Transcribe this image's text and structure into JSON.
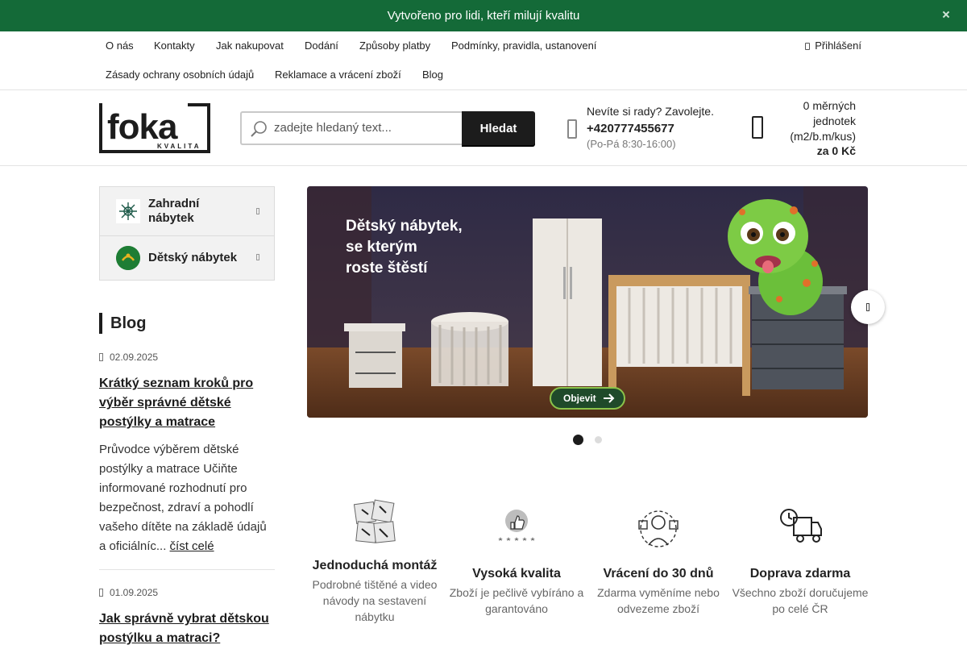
{
  "topbar": {
    "text": "Vytvořeno pro lidi, kteří milují kvalitu"
  },
  "nav": {
    "links": [
      "O nás",
      "Kontakty",
      "Jak nakupovat",
      "Dodání",
      "Způsoby platby",
      "Podmínky, pravidla, ustanovení",
      "Zásady ochrany osobních údajů",
      "Reklamace a vrácení zboží",
      "Blog"
    ],
    "login": "Přihlášení"
  },
  "header": {
    "logo_main": "foka",
    "logo_sub": "KVALITA",
    "search_placeholder": "zadejte hledaný text...",
    "search_button": "Hledat",
    "phone_question": "Nevíte si rady? Zavolejte.",
    "phone_number": "+420777455677",
    "phone_hours": "(Po-Pá 8:30-16:00)",
    "cart_line1": "0 měrných",
    "cart_line2": "jednotek",
    "cart_line3": "(m2/b.m/kus)",
    "cart_price": "za 0 Kč"
  },
  "categories": [
    {
      "label": "Zahradní nábytek",
      "icon": "garden-logo-icon"
    },
    {
      "label": "Dětský nábytek",
      "icon": "gekko-logo-icon"
    }
  ],
  "blog": {
    "title": "Blog",
    "posts": [
      {
        "date": "02.09.2025",
        "title": "Krátký seznam kroků pro výběr správné dětské postýlky a matrace",
        "excerpt": "Průvodce výběrem dětské postýlky a matrace Učiňte informované rozhodnutí pro bezpečnost, zdraví a pohodlí vašeho dítěte na základě údajů a oficiálníc...",
        "read_more": "číst celé"
      },
      {
        "date": "01.09.2025",
        "title": "Jak správně vybrat dětskou postýlku a matraci?"
      }
    ]
  },
  "hero": {
    "line1": "Dětský nábytek,",
    "line2": "se kterým",
    "line3": "roste štěstí",
    "cta": "Objevit"
  },
  "features": [
    {
      "title": "Jednoduchá montáž",
      "desc": "Podrobné tištěné a video návody na sestavení nábytku",
      "icon": "assembly-manual-icon"
    },
    {
      "title": "Vysoká kvalita",
      "desc": "Zboží je pečlivě vybíráno a garantováno",
      "icon": "thumbs-up-rating-icon"
    },
    {
      "title": "Vrácení do 30 dnů",
      "desc": "Zdarma vyměníme nebo odvezeme zboží",
      "icon": "return-exchange-icon"
    },
    {
      "title": "Doprava zdarma",
      "desc": "Všechno zboží doručujeme po celé ČR",
      "icon": "delivery-truck-icon"
    }
  ],
  "colors": {
    "brand_green": "#146a38",
    "dark": "#1c1c1c"
  }
}
